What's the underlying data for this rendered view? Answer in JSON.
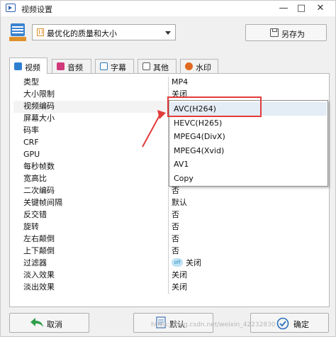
{
  "window": {
    "title": "视频设置",
    "min_icon": "—",
    "max_icon": "□",
    "close_icon": "✕"
  },
  "preset": {
    "selected": "最优化的质量和大小",
    "save_as_label": "另存为"
  },
  "tabs": [
    {
      "label": "视频",
      "icon": "video-icon",
      "color": "#2f7fd1",
      "active": true
    },
    {
      "label": "音频",
      "icon": "music-icon",
      "color": "#d13a7a"
    },
    {
      "label": "字幕",
      "icon": "subtitle-icon",
      "color": "#2a7ab8"
    },
    {
      "label": "其他",
      "icon": "other-icon",
      "color": "#5c5c5c"
    },
    {
      "label": "水印",
      "icon": "watermark-icon",
      "color": "#e06a1f"
    }
  ],
  "properties": [
    {
      "name": "类型",
      "value": "MP4"
    },
    {
      "name": "大小限制",
      "value": "关闭"
    },
    {
      "name": "视频编码",
      "value": ""
    },
    {
      "name": "屏幕大小",
      "value": ""
    },
    {
      "name": "码率",
      "value": ""
    },
    {
      "name": "CRF",
      "value": ""
    },
    {
      "name": "GPU",
      "value": ""
    },
    {
      "name": "每秒帧数",
      "value": ""
    },
    {
      "name": "宽高比",
      "value": ""
    },
    {
      "name": "二次编码",
      "value": "否"
    },
    {
      "name": "关键帧间隔",
      "value": "默认"
    },
    {
      "name": "反交错",
      "value": "否"
    },
    {
      "name": "旋转",
      "value": "否"
    },
    {
      "name": "左右颠倒",
      "value": "否"
    },
    {
      "name": "上下颠倒",
      "value": "否"
    },
    {
      "name": "过滤器",
      "value": "关闭",
      "switch": "off"
    },
    {
      "name": "淡入效果",
      "value": "关闭"
    },
    {
      "name": "淡出效果",
      "value": "关闭"
    }
  ],
  "codec_dropdown": {
    "options": [
      "AVC(H264)",
      "HEVC(H265)",
      "MPEG4(DivX)",
      "MPEG4(Xvid)",
      "AV1",
      "Copy"
    ],
    "highlighted": "AVC(H264)"
  },
  "annotation_color": "#e23b3b",
  "buttons": {
    "cancel": "取消",
    "default": "默认",
    "ok": "确定"
  },
  "watermark": "https://blog.csdn.net/weixin_42232830"
}
